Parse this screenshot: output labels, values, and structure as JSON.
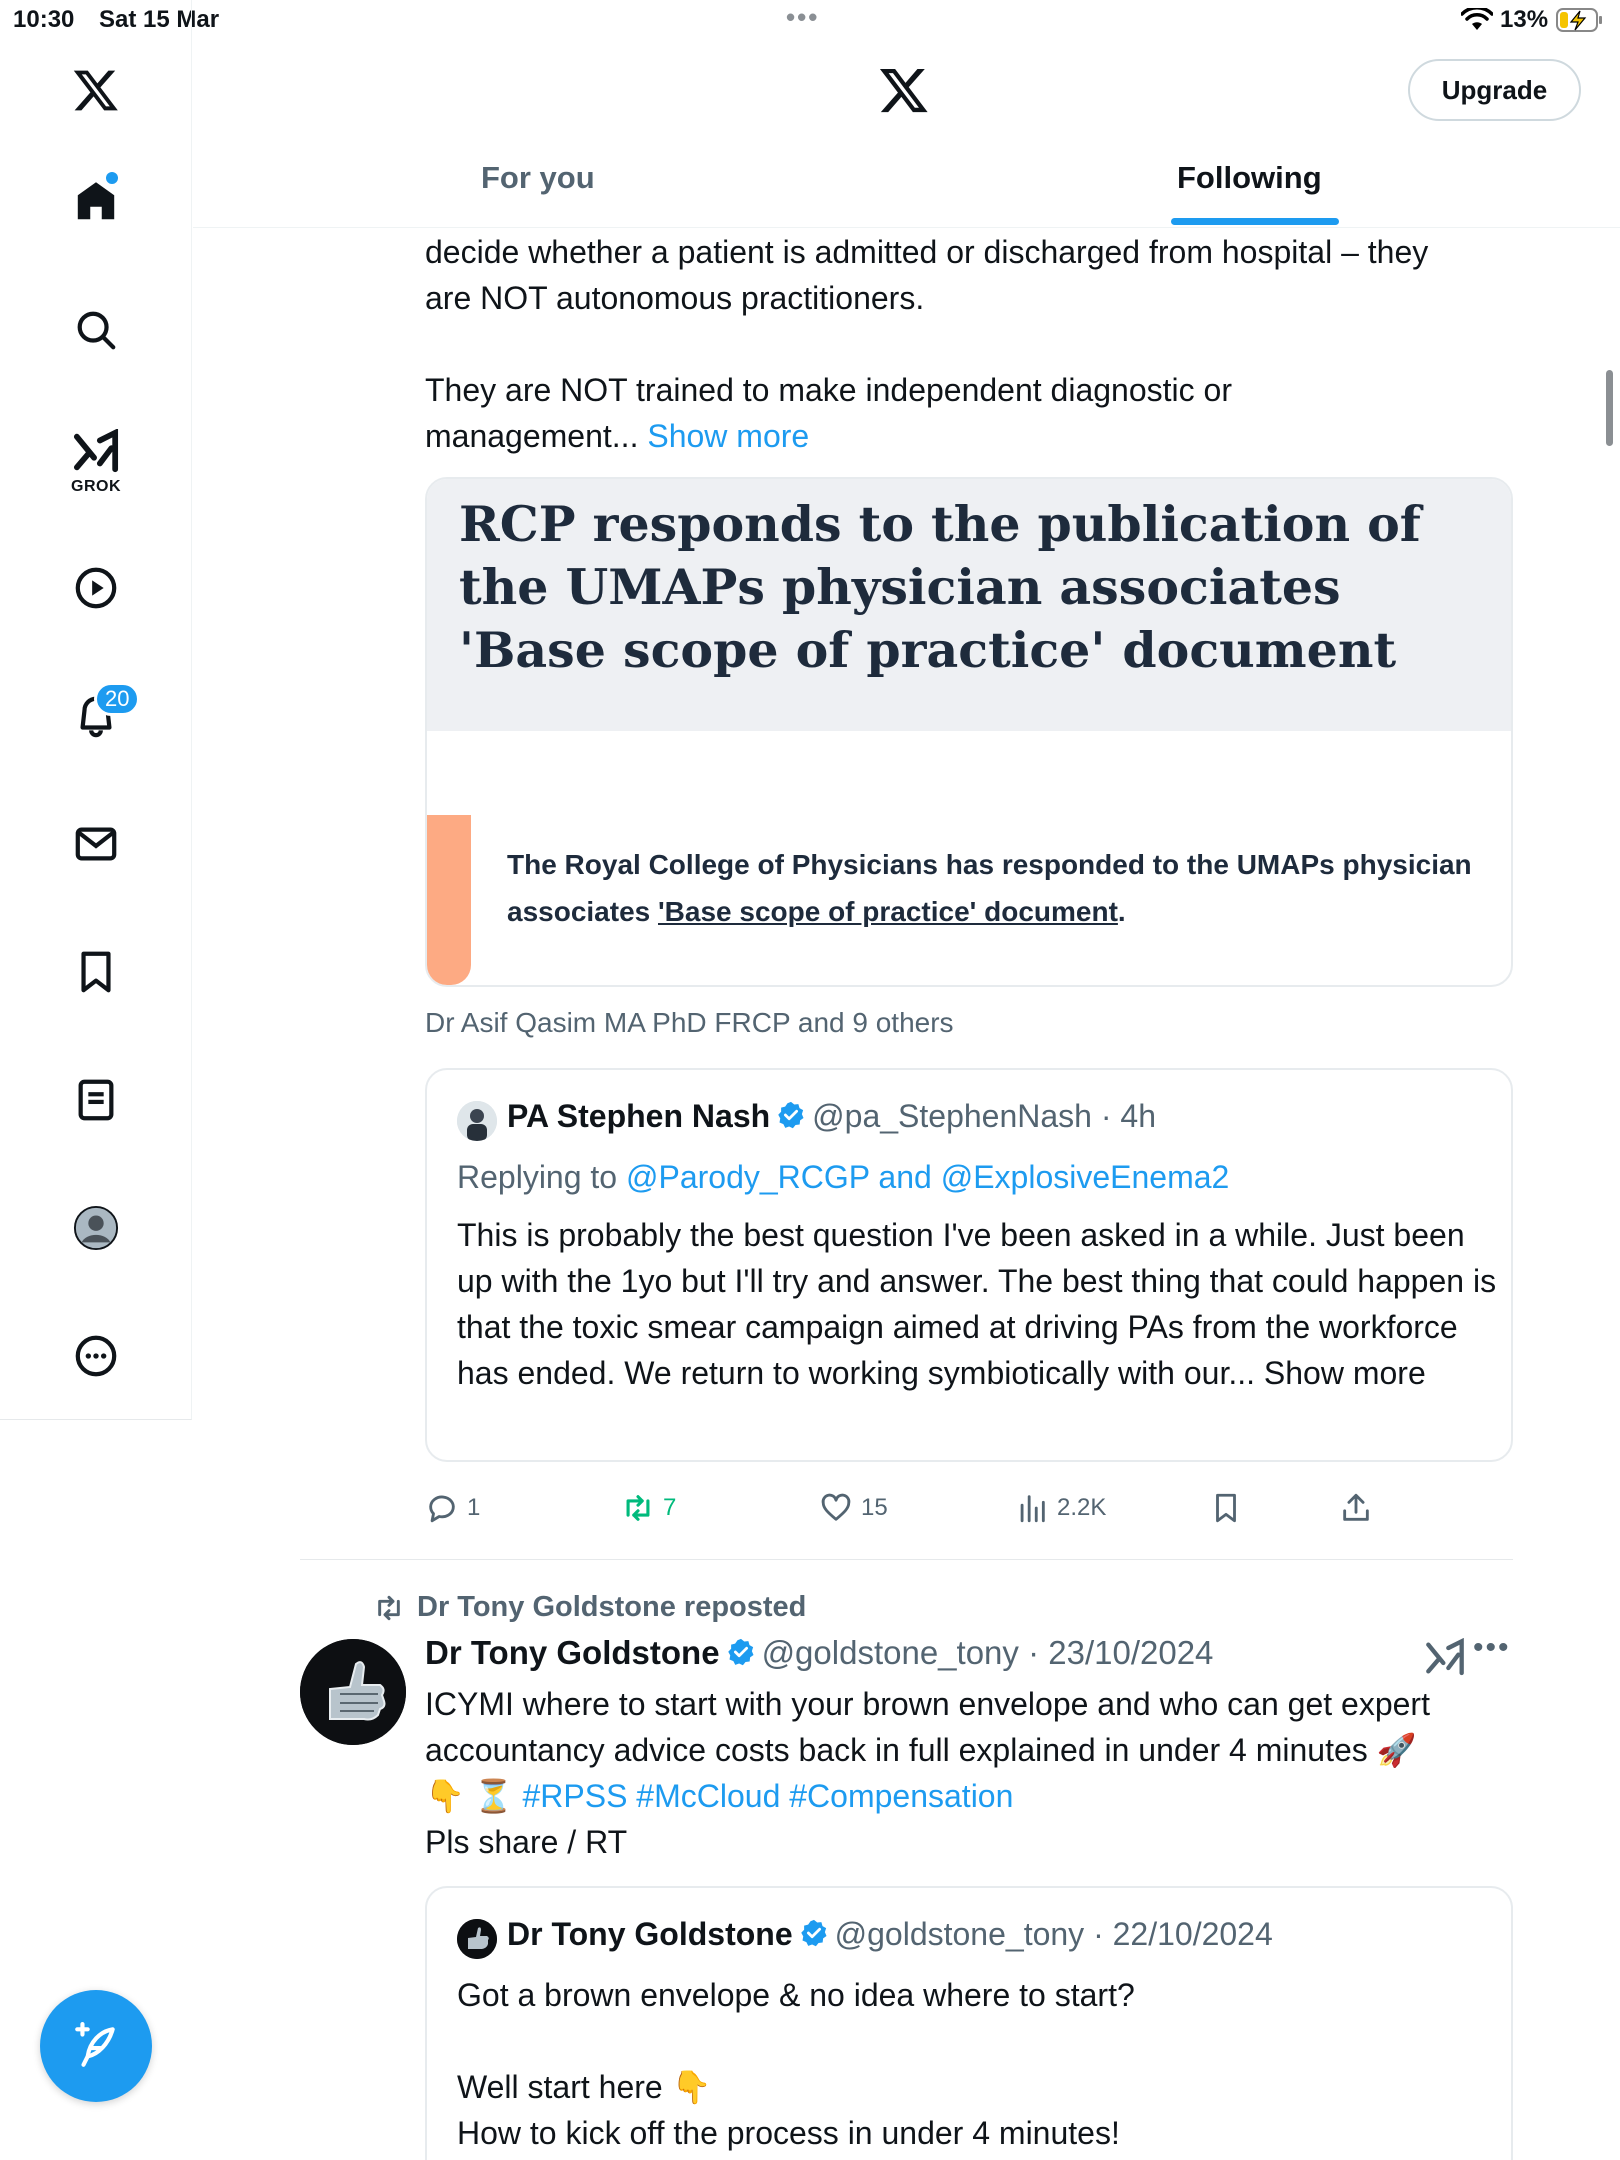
{
  "status_bar": {
    "time": "10:30",
    "date": "Sat 15 Mar",
    "battery_percent": "13%"
  },
  "sidebar": {
    "grok_label": "GROK",
    "notifications_badge": "20"
  },
  "header": {
    "upgrade_label": "Upgrade",
    "tabs": [
      {
        "label": "For you",
        "active": false
      },
      {
        "label": "Following",
        "active": true
      }
    ]
  },
  "tweet1": {
    "text_line1": "decide whether a patient is admitted or discharged from hospital – they",
    "text_line2": "are NOT autonomous practitioners.",
    "text_line3": "They are NOT trained to make independent diagnostic or",
    "text_line4": "management...",
    "show_more": "Show more",
    "card": {
      "title": "RCP responds to the publication of the UMAPs physician associates 'Base scope of practice' document",
      "body_plain": "The Royal College of Physicians has responded to the UMAPs physician associates ",
      "body_link": "'Base scope of practice' document",
      "body_end": "."
    },
    "social_context": "Dr Asif Qasim MA PhD FRCP and 9 others",
    "quote": {
      "name": "PA Stephen Nash",
      "handle_time": "@pa_StephenNash · 4h",
      "replying_prefix": "Replying to",
      "replying_to": "@Parody_RCGP and @ExplosiveEnema2",
      "text": "This is probably the best question I've been asked in a while. Just been up with the 1yo but I'll try and answer. The best thing that could happen is that the toxic smear campaign aimed at driving PAs from the workforce has ended. We return to working symbiotically with our... Show more"
    },
    "actions": {
      "replies": "1",
      "reposts": "7",
      "likes": "15",
      "views": "2.2K"
    }
  },
  "tweet2": {
    "repost_label": "Dr Tony Goldstone reposted",
    "name": "Dr Tony Goldstone",
    "handle_time": "@goldstone_tony · 23/10/2024",
    "text_line1": "ICYMI where to start with your brown envelope and who can get expert",
    "text_line2": "accountancy advice costs back in full explained in under 4 minutes 🚀",
    "text_line3_emoji": "👇 ⏳",
    "hashtags": "#RPSS #McCloud #Compensation",
    "text_line4": "Pls share / RT",
    "quote": {
      "name": "Dr Tony Goldstone",
      "handle_time": "@goldstone_tony · 22/10/2024",
      "line1": "Got a brown envelope & no idea where to start?",
      "line2": "Well start here 👇",
      "line3": "How to kick off the process in under 4 minutes!"
    }
  },
  "colors": {
    "accent": "#1d9bf0",
    "retweet_green": "#00ba7c",
    "muted_text": "#536471",
    "card_accent": "#fdaa83"
  }
}
